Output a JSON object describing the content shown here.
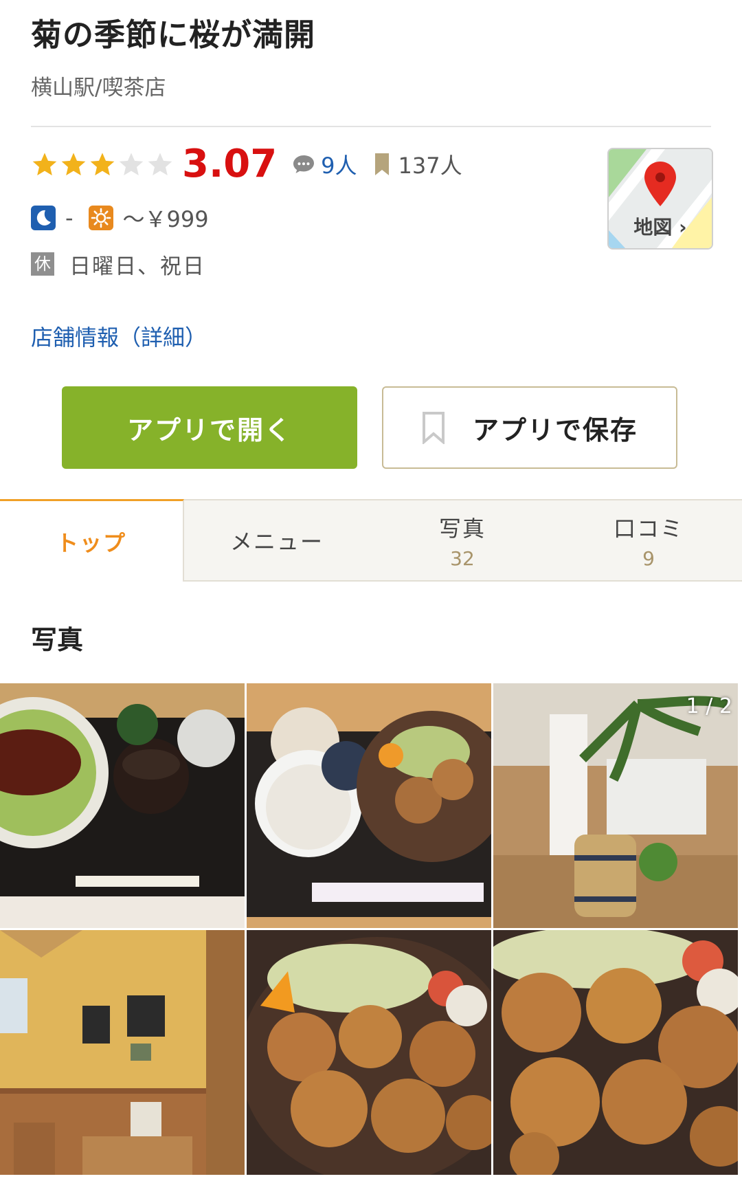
{
  "header": {
    "title": "菊の季節に桜が満開",
    "subtitle": "横山駅/喫茶店"
  },
  "rating": {
    "stars_filled": 3,
    "stars_total": 5,
    "score": "3.07",
    "review_count": "9人",
    "bookmark_count": "137人"
  },
  "price": {
    "dinner": "-",
    "lunch": "～￥999"
  },
  "holiday": {
    "badge": "休",
    "text": "日曜日、祝日"
  },
  "map": {
    "label": "地図"
  },
  "detail_link": "店舗情報（詳細）",
  "buttons": {
    "open_app": "アプリで開く",
    "save_app": "アプリで保存"
  },
  "tabs": [
    {
      "label": "トップ",
      "count": ""
    },
    {
      "label": "メニュー",
      "count": ""
    },
    {
      "label": "写真",
      "count": "32"
    },
    {
      "label": "口コミ",
      "count": "9"
    }
  ],
  "photos_section": {
    "title": "写真",
    "counter": "1 / 2"
  },
  "colors": {
    "accent_orange": "#ef8d1c",
    "score_red": "#d81010",
    "link_blue": "#1f5fb0",
    "button_green": "#86b22a",
    "star_gold": "#f2b21b"
  }
}
